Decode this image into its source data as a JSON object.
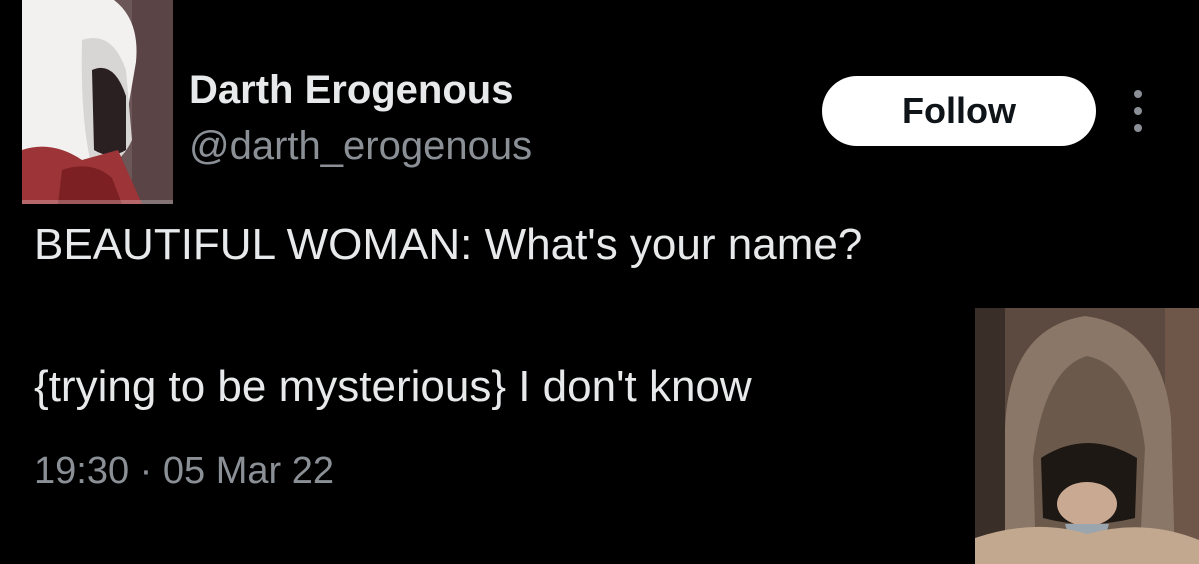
{
  "tweet": {
    "display_name": "Darth Erogenous",
    "handle": "@darth_erogenous",
    "follow_label": "Follow",
    "more_icon": "more-dots-icon",
    "text_line_1": "BEAUTIFUL WOMAN: What's your name?",
    "text_line_2": "{trying to be mysterious} I don't know",
    "timestamp": "19:30 · 05 Mar 22"
  },
  "colors": {
    "background": "#000000",
    "primary_text": "#e7e9ea",
    "secondary_text": "#8b9096",
    "follow_button_bg": "#ffffff",
    "follow_button_text": "#0f1419"
  }
}
